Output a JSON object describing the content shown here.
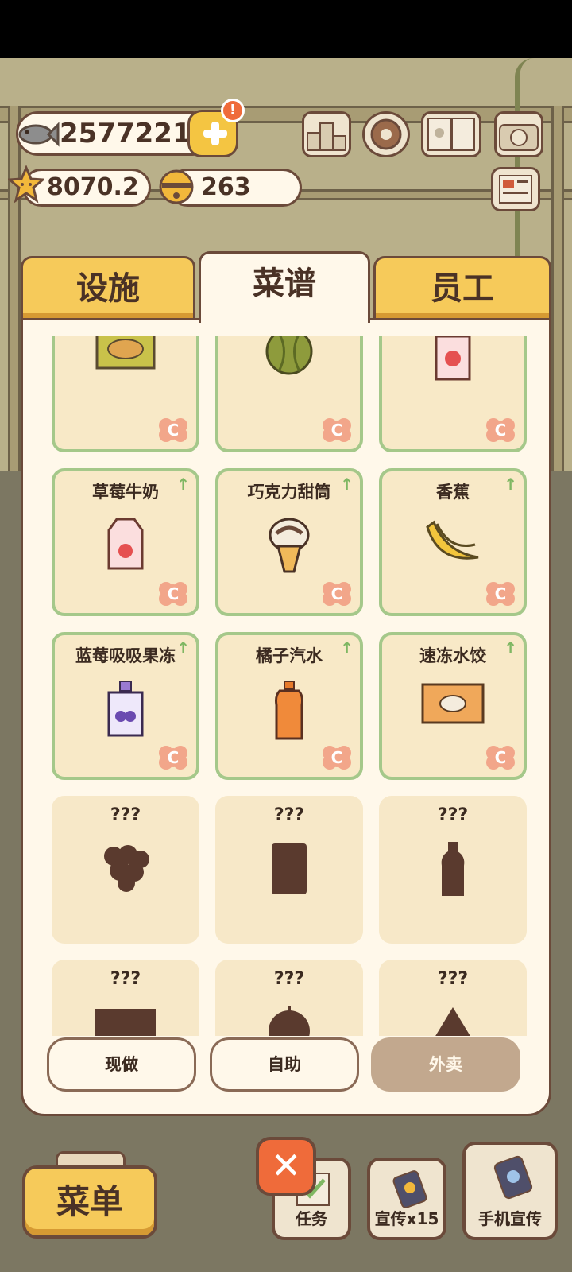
{
  "hud": {
    "fish_count": "2577221",
    "alert_mark": "!",
    "star_rating": "8070.2",
    "bell_count": "263"
  },
  "tabs": [
    {
      "label": "设施",
      "active": false
    },
    {
      "label": "菜谱",
      "active": true
    },
    {
      "label": "员工",
      "active": false
    }
  ],
  "recipes": [
    {
      "name": "",
      "locked": false,
      "food": "taiyaki-pack-icon"
    },
    {
      "name": "",
      "locked": false,
      "food": "watermelon-icon"
    },
    {
      "name": "",
      "locked": false,
      "food": "strawberry-jelly-pouch-icon"
    },
    {
      "name": "草莓牛奶",
      "locked": false,
      "food": "strawberry-milk-icon"
    },
    {
      "name": "巧克力甜筒",
      "locked": false,
      "food": "chocolate-cone-icon"
    },
    {
      "name": "香蕉",
      "locked": false,
      "food": "banana-icon"
    },
    {
      "name": "蓝莓吸吸果冻",
      "locked": false,
      "food": "blueberry-jelly-icon"
    },
    {
      "name": "橘子汽水",
      "locked": false,
      "food": "orange-soda-icon"
    },
    {
      "name": "速冻水饺",
      "locked": false,
      "food": "frozen-dumplings-icon"
    },
    {
      "name": "???",
      "locked": true,
      "food": "grapes-silhouette-icon"
    },
    {
      "name": "???",
      "locked": true,
      "food": "jar-silhouette-icon"
    },
    {
      "name": "???",
      "locked": true,
      "food": "bottle-silhouette-icon"
    },
    {
      "name": "???",
      "locked": true,
      "food": "pack-silhouette-icon"
    },
    {
      "name": "???",
      "locked": true,
      "food": "fruit-silhouette-icon"
    },
    {
      "name": "???",
      "locked": true,
      "food": "triangle-silhouette-icon"
    }
  ],
  "modes": {
    "dine_in": "现做",
    "self_service": "自助",
    "delivery": "外卖",
    "selected": "外卖"
  },
  "bottom_bar": {
    "menu": "菜单",
    "close": "✕",
    "tasks": "任务",
    "promote_x15": "宣传x15",
    "phone_promote": "手机宣传"
  },
  "colors": {
    "tab_yellow": "#f6ca5a",
    "panel_cream": "#fff8ea",
    "card_border_green": "#a5c88a",
    "outline_brown": "#6b4a3a",
    "selected_mode": "#c2a88e",
    "close_orange": "#ef6b3a"
  }
}
